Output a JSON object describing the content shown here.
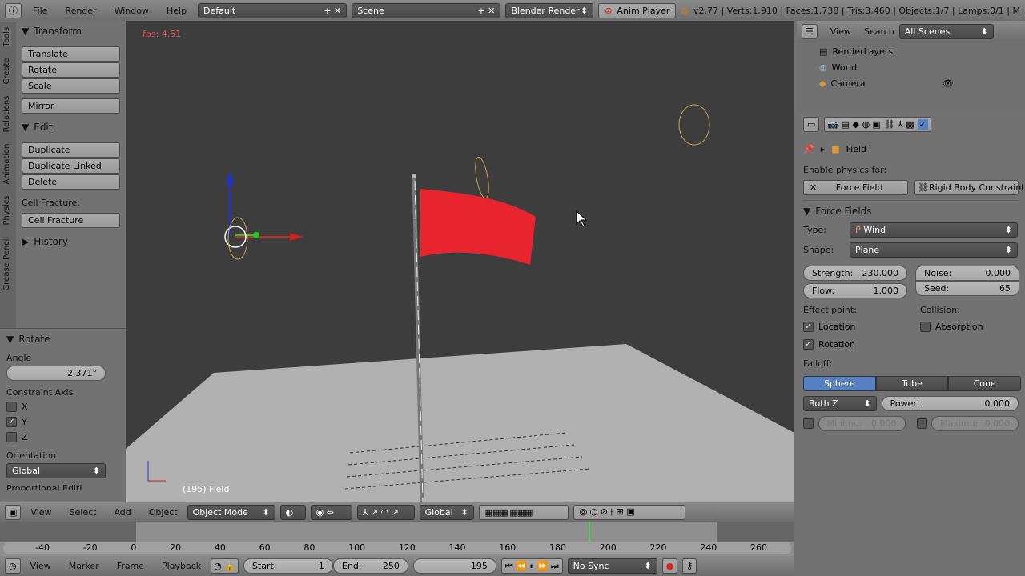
{
  "topbar": {
    "menus": [
      "File",
      "Render",
      "Window",
      "Help"
    ],
    "layout": "Default",
    "scene": "Scene",
    "engine": "Blender Render",
    "anim_player": "Anim Player",
    "stats": "v2.77 | Verts:1,910 | Faces:1,738 | Tris:3,460 | Objects:1/7 | Lamps:0/1 | M"
  },
  "tool_tabs": [
    "Tools",
    "Create",
    "Relations",
    "Animation",
    "Physics",
    "Grease Pencil"
  ],
  "tools": {
    "transform": "Transform",
    "transform_buttons": [
      "Translate",
      "Rotate",
      "Scale"
    ],
    "mirror": "Mirror",
    "edit": "Edit",
    "edit_buttons": [
      "Duplicate",
      "Duplicate Linked",
      "Delete"
    ],
    "cell_fracture_label": "Cell Fracture:",
    "cell_fracture": "Cell Fracture",
    "history": "History"
  },
  "operator": {
    "title": "Rotate",
    "angle_label": "Angle",
    "angle": "2.371°",
    "axis_label": "Constraint Axis",
    "axes": [
      {
        "label": "X",
        "checked": false
      },
      {
        "label": "Y",
        "checked": true
      },
      {
        "label": "Z",
        "checked": false
      }
    ],
    "orientation_label": "Orientation",
    "orientation": "Global",
    "partial": "Proportional Editi..."
  },
  "viewport": {
    "fps": "fps: 4.51",
    "object_label": "(195) Field",
    "flag_color": "#e8252f"
  },
  "view3d_header": {
    "menus": [
      "View",
      "Select",
      "Add",
      "Object"
    ],
    "mode": "Object Mode",
    "orientation": "Global"
  },
  "timeline": {
    "ticks": [
      "-40",
      "-20",
      "0",
      "20",
      "40",
      "60",
      "80",
      "100",
      "120",
      "140",
      "160",
      "180",
      "200",
      "220",
      "240",
      "260"
    ],
    "current_frame": 195,
    "menus": [
      "View",
      "Marker",
      "Frame",
      "Playback"
    ],
    "start_label": "Start:",
    "start": "1",
    "end_label": "End:",
    "end": "250",
    "frame": "195",
    "sync": "No Sync"
  },
  "outliner": {
    "menus": [
      "View",
      "Search"
    ],
    "filter": "All Scenes",
    "items": [
      "RenderLayers",
      "World",
      "Camera"
    ]
  },
  "properties": {
    "object": "Field",
    "enable_label": "Enable physics for:",
    "force_field": "Force Field",
    "rigid": "Rigid Body Constraint",
    "section": "Force Fields",
    "type_label": "Type:",
    "type": "Wind",
    "shape_label": "Shape:",
    "shape": "Plane",
    "strength_label": "Strength:",
    "strength": "230.000",
    "flow_label": "Flow:",
    "flow": "1.000",
    "noise_label": "Noise:",
    "noise": "0.000",
    "seed_label": "Seed:",
    "seed": "65",
    "effect_label": "Effect point:",
    "location": "Location",
    "rotation": "Rotation",
    "collision_label": "Collision:",
    "absorption": "Absorption",
    "falloff_label": "Falloff:",
    "falloff_tabs": [
      "Sphere",
      "Tube",
      "Cone"
    ],
    "falloff_active": "Sphere",
    "bothz": "Both Z",
    "power_label": "Power:",
    "power": "0.000",
    "min_label": "Minimu:",
    "min": "0.000",
    "max_label": "Maximu:",
    "max": "0.000",
    "accent": "#5680c2"
  }
}
